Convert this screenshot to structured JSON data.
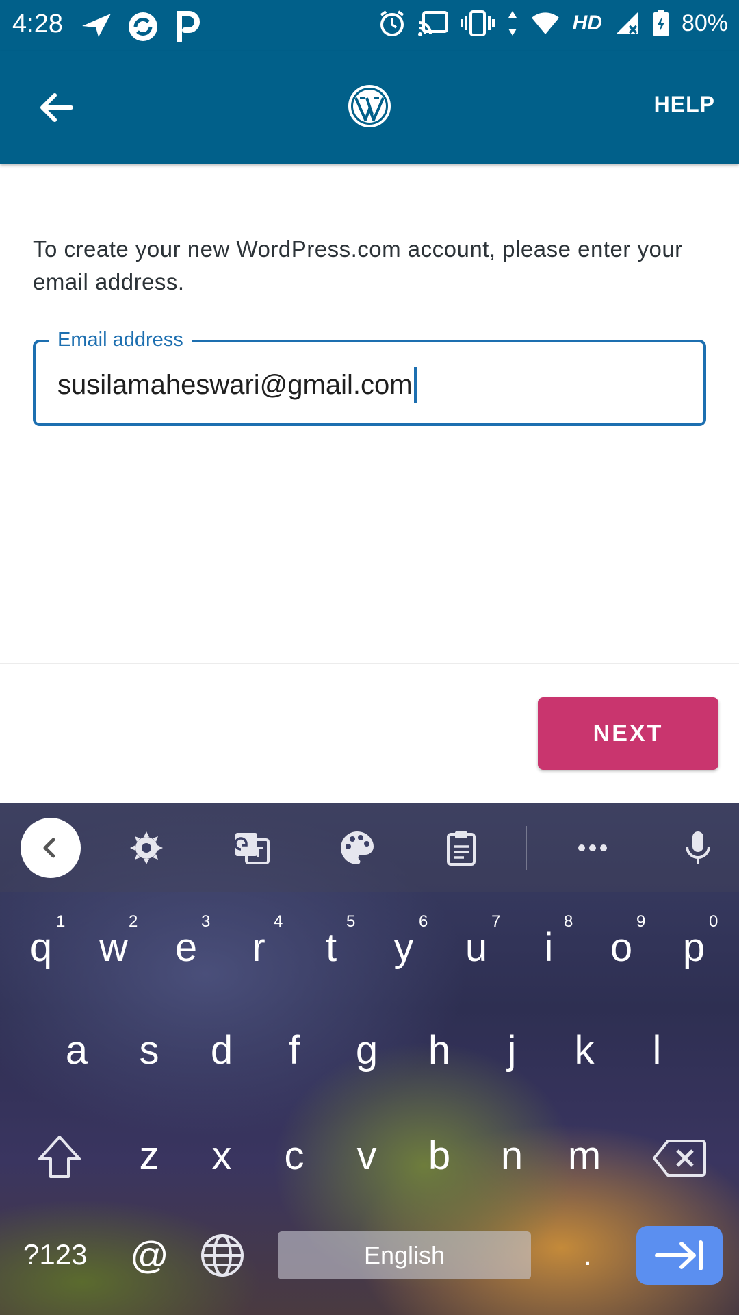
{
  "status_bar": {
    "time": "4:28",
    "battery": "80%",
    "network_badge": "HD",
    "icons_left": [
      "send-icon",
      "sync-icon",
      "parking-icon"
    ],
    "icons_right": [
      "alarm-icon",
      "cast-icon",
      "vibrate-icon",
      "data-arrows-icon",
      "wifi-icon",
      "signal-icon",
      "battery-icon"
    ]
  },
  "app_bar": {
    "help_label": "HELP",
    "color": "#01608a"
  },
  "main": {
    "intro_text": "To create your new WordPress.com account, please enter your email address.",
    "email_label": "Email address",
    "email_value": "susilamaheswari@gmail.com",
    "next_label": "NEXT",
    "accent": "#1d6fb0",
    "next_color": "#c9356e"
  },
  "keyboard": {
    "toolbar": [
      "chevron-left-icon",
      "settings-gear-icon",
      "translate-icon",
      "palette-icon",
      "clipboard-icon",
      "more-dots-icon",
      "microphone-icon"
    ],
    "row1": [
      {
        "key": "q",
        "num": "1"
      },
      {
        "key": "w",
        "num": "2"
      },
      {
        "key": "e",
        "num": "3"
      },
      {
        "key": "r",
        "num": "4"
      },
      {
        "key": "t",
        "num": "5"
      },
      {
        "key": "y",
        "num": "6"
      },
      {
        "key": "u",
        "num": "7"
      },
      {
        "key": "i",
        "num": "8"
      },
      {
        "key": "o",
        "num": "9"
      },
      {
        "key": "p",
        "num": "0"
      }
    ],
    "row2": [
      "a",
      "s",
      "d",
      "f",
      "g",
      "h",
      "j",
      "k",
      "l"
    ],
    "row3": [
      "z",
      "x",
      "c",
      "v",
      "b",
      "n",
      "m"
    ],
    "symbols_label": "?123",
    "at_label": "@",
    "space_label": "English",
    "period_label": "."
  }
}
